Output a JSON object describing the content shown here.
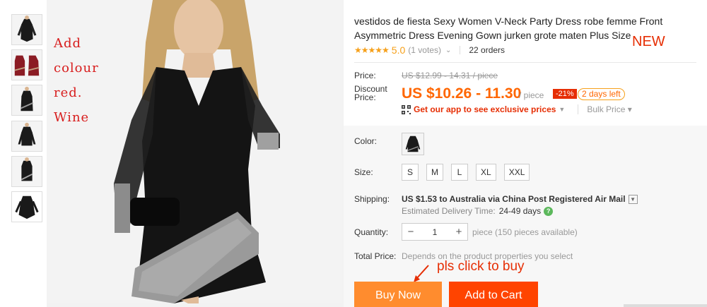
{
  "thumbnails": [
    {
      "name": "thumb-1",
      "color": "#1a1a1a"
    },
    {
      "name": "thumb-2",
      "color": "#8b1c24"
    },
    {
      "name": "thumb-3",
      "color": "#1a1a1a"
    },
    {
      "name": "thumb-4",
      "color": "#1a1a1a"
    },
    {
      "name": "thumb-5",
      "color": "#1a1a1a"
    },
    {
      "name": "thumb-6",
      "color": "#1a1a1a"
    }
  ],
  "note": {
    "line1": "Add",
    "line2": "colour",
    "line3": "red.",
    "line4": "Wine"
  },
  "product": {
    "title": "vestidos de fiesta Sexy Women V-Neck Party Dress robe femme Front Asymmetric Dress Evening Gown jurken grote maten Plus Size",
    "new_tag": "NEW",
    "stars": "★★★★★",
    "score": "5.0",
    "votes": "(1 votes)",
    "orders": "22 orders"
  },
  "pricing": {
    "price_label": "Price:",
    "old_price": "US $12.99 - 14.31 / piece",
    "discount_label_1": "Discount",
    "discount_label_2": "Price:",
    "price": "US $10.26 - 11.30",
    "per_piece": "/ piece",
    "discount": "-21%",
    "days_left": "2 days left",
    "app_text": "Get our app to see exclusive prices",
    "bulk_price": "Bulk Price ▾"
  },
  "options": {
    "color_label": "Color:",
    "size_label": "Size:",
    "sizes": [
      "S",
      "M",
      "L",
      "XL",
      "XXL"
    ],
    "shipping_label": "Shipping:",
    "shipping_text": "US $1.53 to Australia via China Post Registered Air Mail",
    "delivery_label": "Estimated Delivery Time:",
    "delivery_time": "24-49 days",
    "quantity_label": "Quantity:",
    "quantity": "1",
    "quantity_note": "piece (150 pieces available)",
    "total_label": "Total Price:",
    "total_note": "Depends on the product properties you select"
  },
  "actions": {
    "pls_note": "pls click to buy",
    "buy_now": "Buy Now",
    "add_to_cart": "Add to Cart"
  },
  "colors": {
    "accent": "#ff6600",
    "buy_now": "#ff8c2e",
    "add_to_cart": "#ff4400",
    "red": "#e62e04",
    "star": "#f6a01a"
  }
}
